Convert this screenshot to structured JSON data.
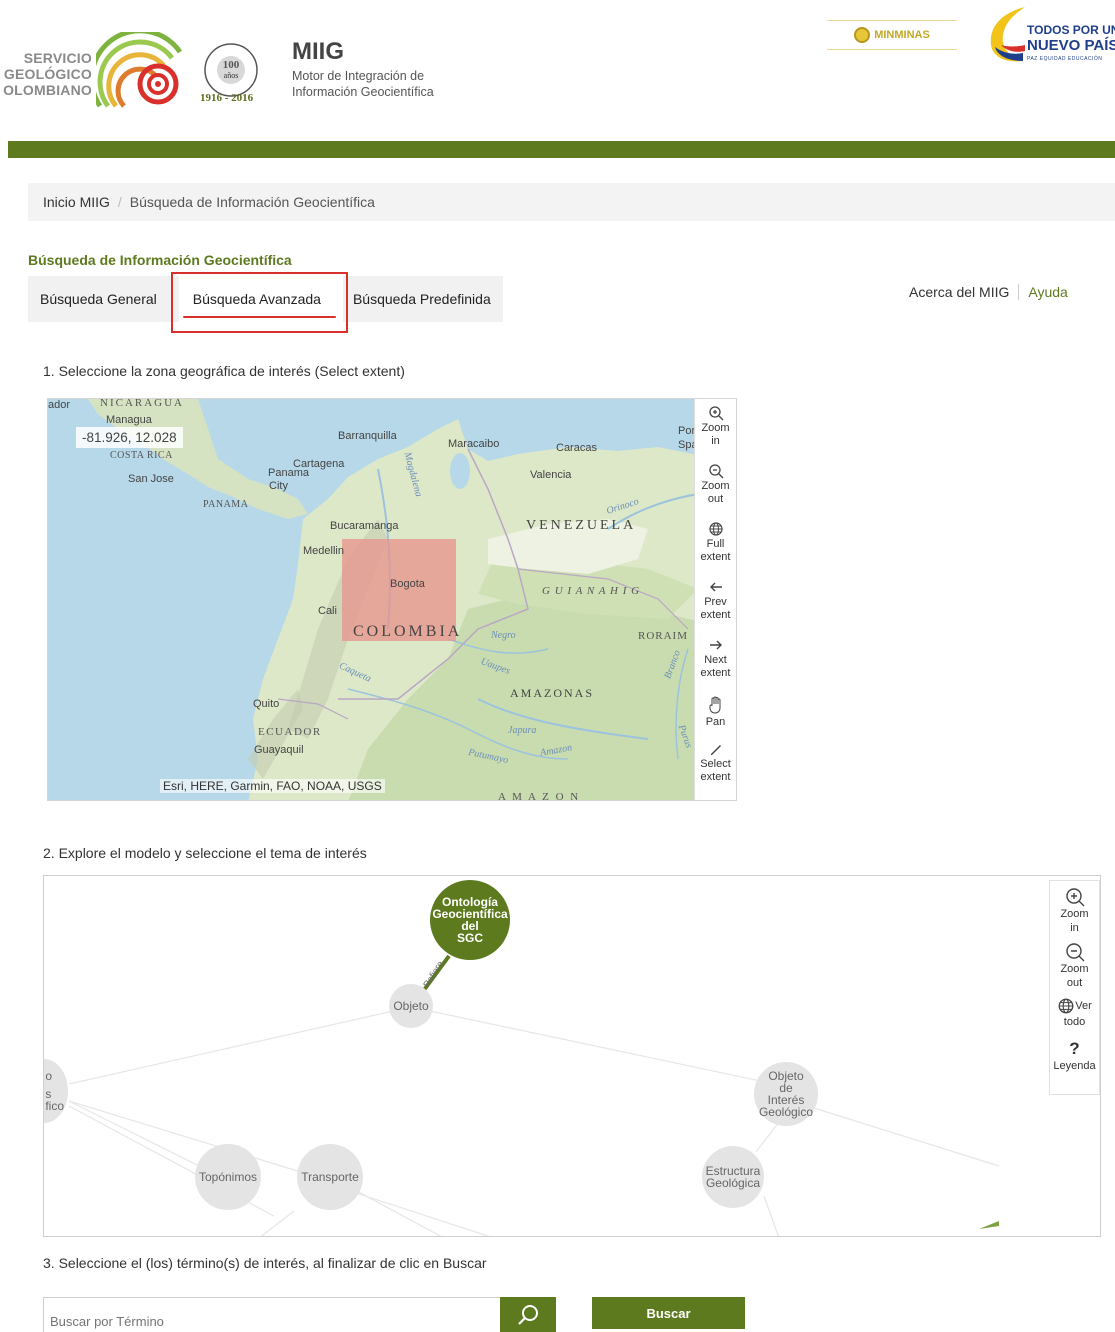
{
  "header": {
    "sgc_text": [
      "SERVICIO",
      "GEOLÓGICO",
      "OLOMBIANO"
    ],
    "centenary_years": "1916 - 2016",
    "app_title": "MIIG",
    "app_subtitle_1": "Motor de Integración de",
    "app_subtitle_2": "Información Geocientífica",
    "minminas": "MINMINAS",
    "todos_1": "TODOS POR UN",
    "todos_2": "NUEVO PAÍS",
    "todos_3": "PAZ  EQUIDAD  EDUCACIÓN"
  },
  "breadcrumb": {
    "home": "Inicio MIIG",
    "separator": "/",
    "current": "Búsqueda de Información Geocientífica"
  },
  "section_title": "Búsqueda de Información Geocientífica",
  "tabs": [
    {
      "label": "Búsqueda General"
    },
    {
      "label": "Búsqueda Avanzada"
    },
    {
      "label": "Búsqueda Predefinida"
    }
  ],
  "links": {
    "about": "Acerca del MIIG",
    "help": "Ayuda"
  },
  "steps": {
    "step1": "1. Seleccione la zona geográfica de interés (Select extent)",
    "step2": "2. Explore el modelo y seleccione el tema de interés",
    "step3": "3. Seleccione el (los) término(s) de interés, al finalizar de clic en Buscar"
  },
  "map": {
    "coords": "-81.926, 12.028",
    "attribution": "Esri, HERE, Garmin, FAO, NOAA, USGS",
    "labels": {
      "nicaragua": "NICARAGUA",
      "managua": "Managua",
      "ador": "ador",
      "costa_rica": "COSTA RICA",
      "san_jose": "San Jose",
      "panama_city_1": "Panama",
      "panama_city_2": "City",
      "panama": "PANAMA",
      "barranquilla": "Barranquilla",
      "cartagena": "Cartagena",
      "maracaibo": "Maracaibo",
      "caracas": "Caracas",
      "valencia": "Valencia",
      "por": "Por",
      "spa": "Spa",
      "orinoco": "Orinoco",
      "venezuela": "VENEZUELA",
      "bucaramanga": "Bucaramanga",
      "medellin": "Medellin",
      "bogota": "Bogota",
      "cali": "Cali",
      "colombia": "COLOMBIA",
      "guiana": "G U I A N A   H I G",
      "roraima": "RORAIM",
      "negro": "Negro",
      "magdalena": "Magdalena",
      "japura": "Japura",
      "amazonas": "AMAZONAS",
      "quito": "Quito",
      "ecuador": "ECUADOR",
      "guayaquil": "Guayaquil",
      "putumayo": "Putumayo",
      "amazon": "Amazon",
      "amazon_bottom": "A  M  A  Z  O  N",
      "caqueta": "Caqueta",
      "branco": "Branco",
      "purus": "Purus",
      "uapes": "Uaupes"
    },
    "tools": [
      {
        "icon": "zoom-in-icon",
        "label1": "Zoom",
        "label2": "in"
      },
      {
        "icon": "zoom-out-icon",
        "label1": "Zoom",
        "label2": "out"
      },
      {
        "icon": "globe-icon",
        "label1": "Full",
        "label2": "extent"
      },
      {
        "icon": "arrow-left-icon",
        "label1": "Prev",
        "label2": "extent"
      },
      {
        "icon": "arrow-right-icon",
        "label1": "Next",
        "label2": "extent"
      },
      {
        "icon": "hand-icon",
        "label1": "Pan",
        "label2": ""
      },
      {
        "icon": "pencil-icon",
        "label1": "Select",
        "label2": "extent"
      }
    ]
  },
  "graph": {
    "root": [
      "Ontología",
      "Geocientífica",
      "del",
      "SGC"
    ],
    "edge_label": "Refiere",
    "nodes": {
      "objeto": "Objeto",
      "objeto_interes": [
        "Objeto",
        "de",
        "Interés",
        "Geológico"
      ],
      "toponimos": "Topónimos",
      "transporte": "Transporte",
      "estructura": [
        "Estructura",
        "Geológica"
      ],
      "left_partial": [
        "o",
        "s",
        "fico"
      ]
    },
    "tools": [
      {
        "icon": "zoom-in-icon",
        "label1": "Zoom",
        "label2": "in"
      },
      {
        "icon": "zoom-out-icon",
        "label1": "Zoom",
        "label2": "out"
      },
      {
        "icon": "globe-icon",
        "label1": "Ver",
        "label2": "todo"
      },
      {
        "icon": "question-icon",
        "label1": "Leyenda",
        "label2": ""
      }
    ]
  },
  "search": {
    "placeholder": "Buscar por Término",
    "button": "Buscar"
  },
  "colors": {
    "brand_green": "#5d7a1f",
    "highlight_red": "#d9302c",
    "selection_fill": "#e8928c"
  }
}
